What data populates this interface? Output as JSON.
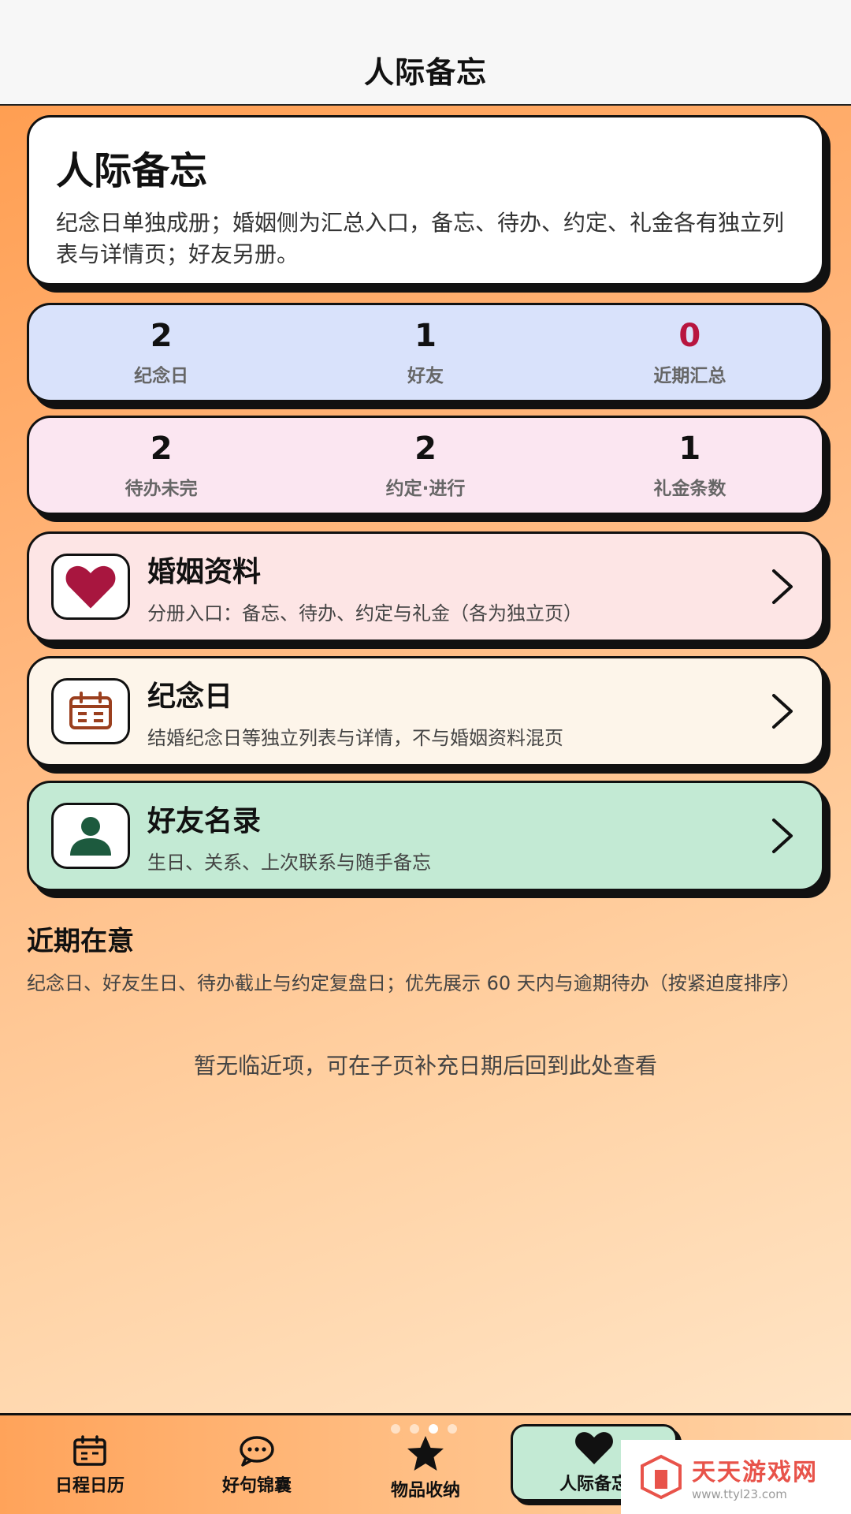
{
  "header": {
    "title": "人际备忘"
  },
  "intro": {
    "title": "人际备忘",
    "description": "纪念日单独成册；婚姻侧为汇总入口，备忘、待办、约定、礼金各有独立列表与详情页；好友另册。"
  },
  "stats_row1": [
    {
      "value": "2",
      "label": "纪念日"
    },
    {
      "value": "1",
      "label": "好友"
    },
    {
      "value": "0",
      "label": "近期汇总"
    }
  ],
  "stats_row2": [
    {
      "value": "2",
      "label": "待办未完"
    },
    {
      "value": "2",
      "label": "约定·进行"
    },
    {
      "value": "1",
      "label": "礼金条数"
    }
  ],
  "nav_cards": {
    "marriage": {
      "title": "婚姻资料",
      "subtitle": "分册入口：备忘、待办、约定与礼金（各为独立页）"
    },
    "anniversary": {
      "title": "纪念日",
      "subtitle": "结婚纪念日等独立列表与详情，不与婚姻资料混页"
    },
    "friends": {
      "title": "好友名录",
      "subtitle": "生日、关系、上次联系与随手备忘"
    }
  },
  "recent": {
    "title": "近期在意",
    "description": "纪念日、好友生日、待办截止与约定复盘日；优先展示 60 天内与逾期待办（按紧迫度排序）",
    "empty": "暂无临近项，可在子页补充日期后回到此处查看"
  },
  "tabs": [
    {
      "label": "日程日历",
      "icon": "calendar-icon"
    },
    {
      "label": "好句锦囊",
      "icon": "chat-bubble-icon"
    },
    {
      "label": "物品收纳",
      "icon": "star-icon"
    },
    {
      "label": "人际备忘",
      "icon": "heart-icon"
    }
  ],
  "watermark": {
    "title": "天天游戏网",
    "url": "www.ttyl23.com"
  },
  "colors": {
    "accent_red": "#b8153f",
    "heart": "#a8163f",
    "calendar": "#9b3f1e",
    "person": "#1d5a3e",
    "active_tab": "#c3ead4"
  }
}
